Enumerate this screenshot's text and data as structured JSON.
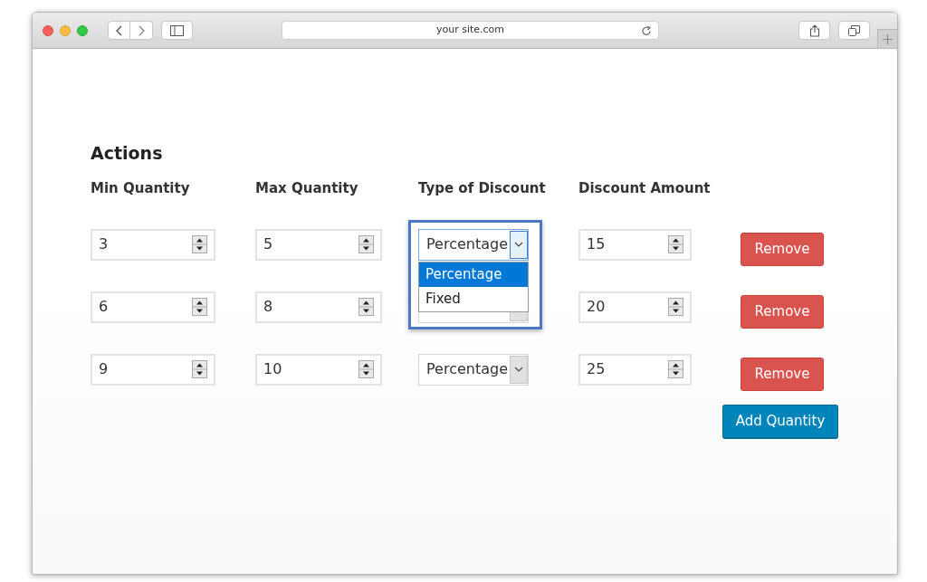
{
  "browser": {
    "url": "your site.com"
  },
  "heading": "Actions",
  "columns": [
    "Min Quantity",
    "Max Quantity",
    "Type of Discount",
    "Discount Amount"
  ],
  "rows": [
    {
      "min": "3",
      "max": "5",
      "type": "Percentage",
      "amount": "15",
      "remove": "Remove",
      "dropdown_open": true,
      "options": [
        {
          "label": "Percentage",
          "selected": true
        },
        {
          "label": "Fixed",
          "selected": false
        }
      ]
    },
    {
      "min": "6",
      "max": "8",
      "amount": "20",
      "remove": "Remove",
      "dropdown_open": false
    },
    {
      "min": "9",
      "max": "10",
      "type": "Percentage",
      "amount": "25",
      "remove": "Remove",
      "dropdown_open": false
    }
  ],
  "add_button": "Add Quantity"
}
